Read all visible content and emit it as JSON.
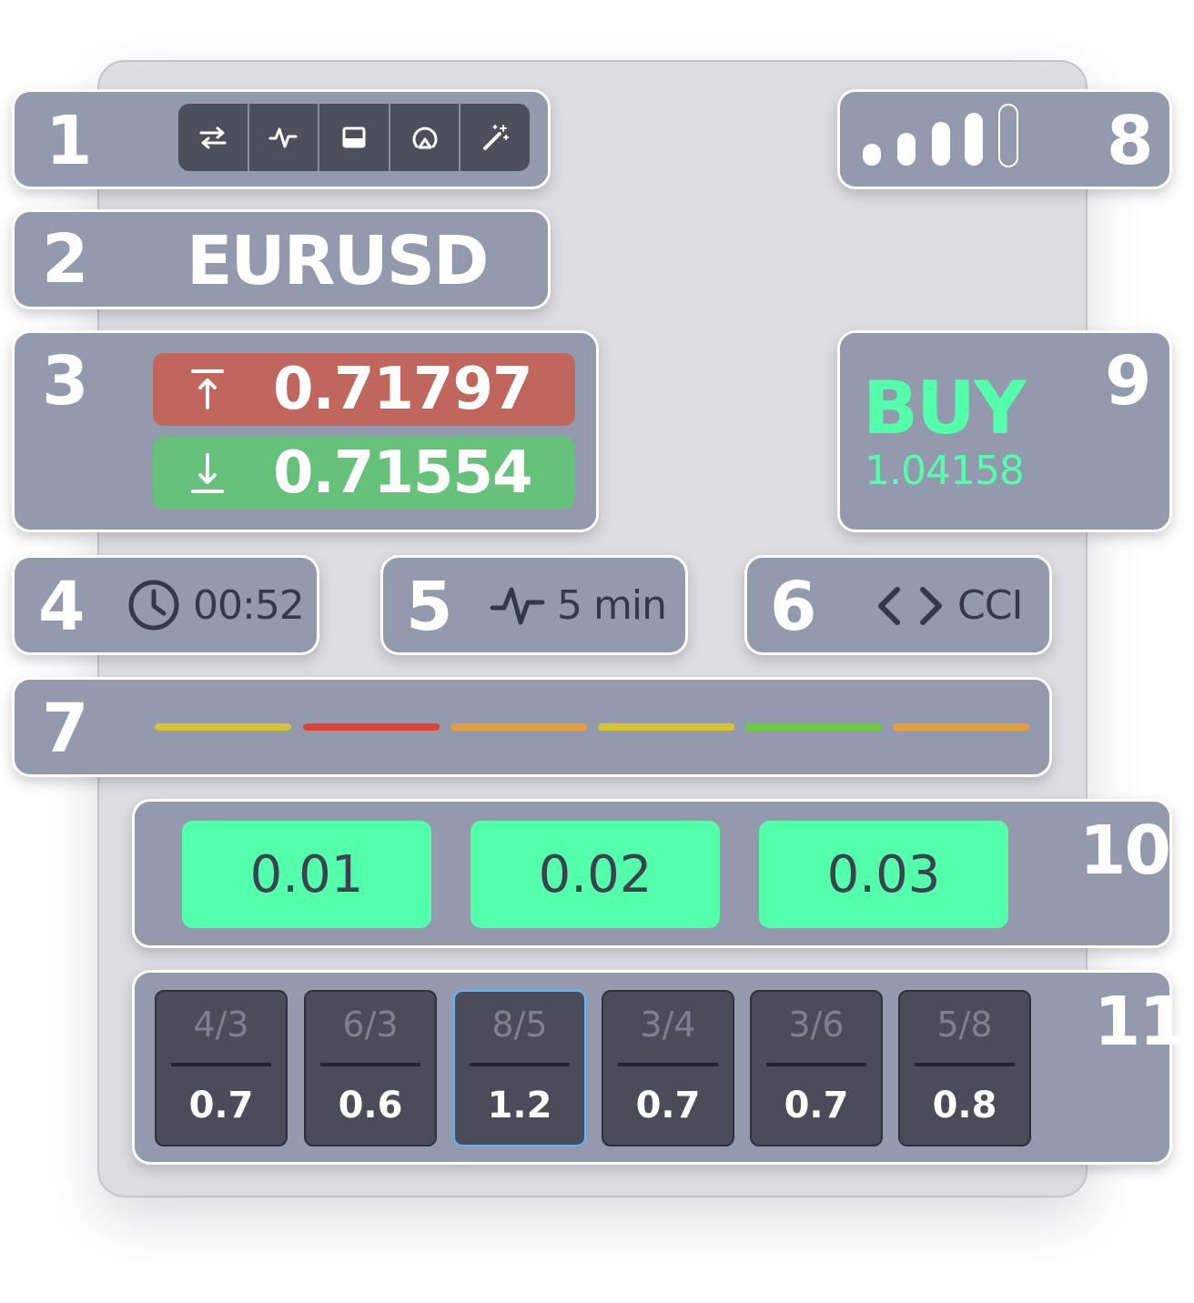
{
  "panels": {
    "toolbar": {
      "number": "1",
      "icons": [
        "swap-arrows-icon",
        "pulse-wave-icon",
        "window-icon",
        "gauge-icon",
        "magic-wand-icon"
      ]
    },
    "symbol": {
      "number": "2",
      "value": "EURUSD"
    },
    "levels": {
      "number": "3",
      "upper": "0.71797",
      "lower": "0.71554",
      "upper_color": "#c0665c",
      "lower_color": "#66c17a"
    },
    "timer": {
      "number": "4",
      "value": "00:52"
    },
    "timeframe": {
      "number": "5",
      "value": "5 min"
    },
    "indicator": {
      "number": "6",
      "value": "CCI"
    },
    "strength": {
      "number": "7",
      "segments": [
        "#d9c531",
        "#dd4433",
        "#e3a03c",
        "#d9c531",
        "#6dcc3a",
        "#e3a03c"
      ]
    },
    "signal": {
      "number": "8",
      "level": "4 of 5"
    },
    "direction": {
      "number": "9",
      "label": "BUY",
      "price": "1.04158",
      "color": "#54ffac"
    },
    "lots": {
      "number": "10",
      "values": [
        "0.01",
        "0.02",
        "0.03"
      ]
    },
    "ratios": {
      "number": "11",
      "items": [
        {
          "top": "4/3",
          "bottom": "0.7"
        },
        {
          "top": "6/3",
          "bottom": "0.6"
        },
        {
          "top": "8/5",
          "bottom": "1.2"
        },
        {
          "top": "3/4",
          "bottom": "0.7"
        },
        {
          "top": "3/6",
          "bottom": "0.7"
        },
        {
          "top": "5/8",
          "bottom": "0.8"
        }
      ],
      "selected": "8/5"
    }
  }
}
